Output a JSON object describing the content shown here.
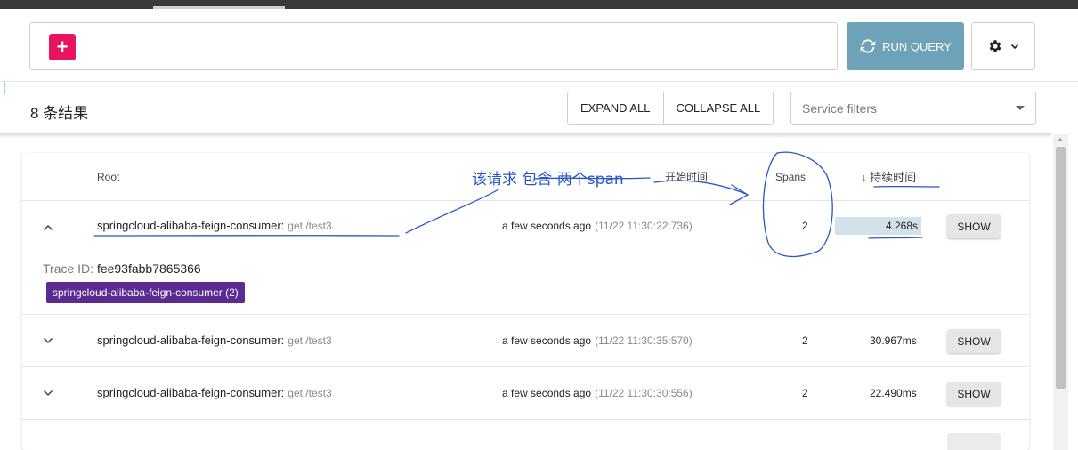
{
  "toolbar": {
    "add_label": "+",
    "run_query_label": "RUN QUERY"
  },
  "results": {
    "count_label": "8 条结果",
    "expand_all_label": "EXPAND ALL",
    "collapse_all_label": "COLLAPSE ALL",
    "service_filter_placeholder": "Service filters"
  },
  "table": {
    "headers": {
      "root": "Root",
      "start_time": "开始时间",
      "spans": "Spans",
      "duration": "↓ 持续时间"
    },
    "rows": [
      {
        "service": "springcloud-alibaba-feign-consumer:",
        "operation": "get /test3",
        "relative_time": "a few seconds ago",
        "absolute_time": "(11/22 11:30:22:736)",
        "spans": "2",
        "duration": "4.268s",
        "duration_fraction": 0.14,
        "expanded": true,
        "trace_id_label": "Trace ID:",
        "trace_id": "fee93fabb7865366",
        "service_badge": "springcloud-alibaba-feign-consumer (2)",
        "show_label": "SHOW"
      },
      {
        "service": "springcloud-alibaba-feign-consumer:",
        "operation": "get /test3",
        "relative_time": "a few seconds ago",
        "absolute_time": "(11/22 11:30:35:570)",
        "spans": "2",
        "duration": "30.967ms",
        "expanded": false,
        "show_label": "SHOW"
      },
      {
        "service": "springcloud-alibaba-feign-consumer:",
        "operation": "get /test3",
        "relative_time": "a few seconds ago",
        "absolute_time": "(11/22 11:30:30:556)",
        "spans": "2",
        "duration": "22.490ms",
        "expanded": false,
        "show_label": "SHOW"
      }
    ]
  },
  "annotation": {
    "text": "该请求 包含 两个span",
    "ink_color": "#2856c8"
  },
  "colors": {
    "add_button": "#e8155e",
    "run_query": "#6ea2b9",
    "service_badge": "#5a2b93",
    "duration_bar": "#d3e1ea"
  }
}
